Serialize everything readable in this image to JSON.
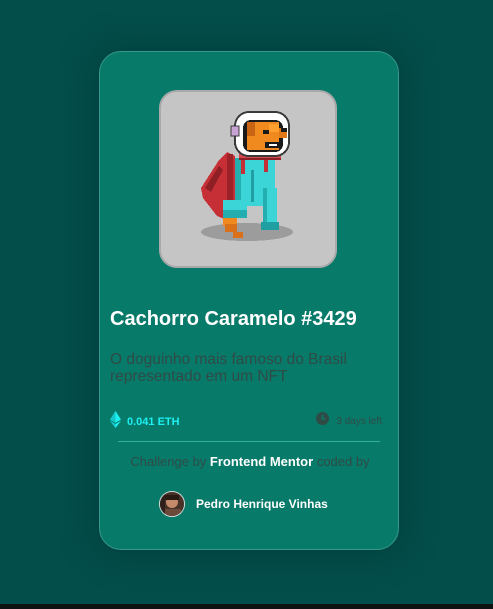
{
  "card": {
    "image_alt": "pixel art caramel dog in astronaut suit",
    "title": "Cachorro Caramelo #3429",
    "description": "O doguinho mais famoso do Brasil representado em um NFT",
    "price": {
      "icon": "ethereum-icon",
      "label": "0.041 ETH"
    },
    "time": {
      "icon": "clock-icon",
      "label": "3 days left"
    },
    "attribution": {
      "prefix": "Challenge by",
      "link_label": "Frontend Mentor",
      "suffix": "coded by"
    },
    "author": {
      "avatar_icon": "avatar-photo",
      "name": "Pedro Henrique Vinhas"
    }
  },
  "colors": {
    "page_background": "#034d4a",
    "card_background": "#087a6a",
    "accent_cyan": "#1cf0f2",
    "muted_text": "#2f4b46",
    "white_text": "#ffffff"
  }
}
